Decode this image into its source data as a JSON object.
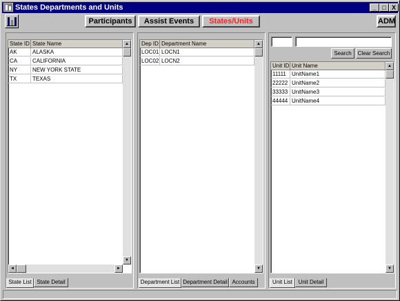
{
  "window": {
    "title": "States Departments and Units",
    "controls": [
      "_",
      "□",
      "X"
    ]
  },
  "toolbar": {
    "logo_icon": "app-building-icon",
    "participants_label": "Participants",
    "assist_events_label": "Assist Events",
    "states_units_label": "States/Units",
    "user_label": "ADM",
    "active_color": "#ff2020"
  },
  "states": {
    "headers": [
      "State ID",
      "State Name"
    ],
    "rows": [
      {
        "id": "AK",
        "name": "ALASKA"
      },
      {
        "id": "CA",
        "name": "CALIFORNIA"
      },
      {
        "id": "NY",
        "name": "NEW YORK STATE"
      },
      {
        "id": "TX",
        "name": "TEXAS"
      }
    ],
    "tabs": [
      "State List",
      "State Detail"
    ]
  },
  "departments": {
    "headers": [
      "Dep ID",
      "Department Name"
    ],
    "rows": [
      {
        "id": "LOC01",
        "name": "LOCN1"
      },
      {
        "id": "LOC02",
        "name": "LOCN2"
      }
    ],
    "tabs": [
      "Department List",
      "Department Detail",
      "Accounts"
    ]
  },
  "units": {
    "search_label": "Search",
    "clear_search_label": "Clear Search",
    "id_input_value": "",
    "name_input_value": "",
    "headers": [
      "Unit ID",
      "Unit Name"
    ],
    "rows": [
      {
        "id": "11111",
        "name": "UnitName1"
      },
      {
        "id": "22222",
        "name": "UnitName2"
      },
      {
        "id": "33333",
        "name": "UnitName3"
      },
      {
        "id": "44444",
        "name": "UnitName4"
      }
    ],
    "tabs": [
      "Unit List",
      "Unit Detail"
    ]
  }
}
